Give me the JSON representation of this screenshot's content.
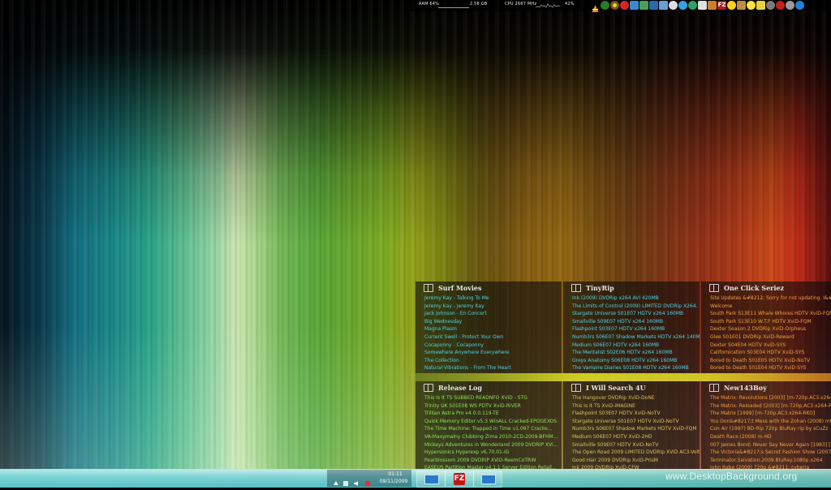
{
  "top_bar": {
    "ram_label": "RAM 64%",
    "ram_value": "2.58 GB",
    "cpu_label": "CPU 2667 MHz",
    "cpu_percent": "42%"
  },
  "feeds": [
    {
      "title": "Surf Movies",
      "color": "cA",
      "items": [
        "Jeremy Kay - Talking To Me",
        "Jeremy Kay - Jeremy Kay",
        "Jack Johnson - En Concert",
        "Big Wednesday",
        "Magna Plasm",
        "Current Swell - Protect Your Own",
        "Cocaponny - Cocaponny",
        "Somewhere Anywhere Everywhere",
        "The Collection",
        "Natural Vibrations - From The Heart"
      ]
    },
    {
      "title": "TinyRip",
      "color": "cA",
      "items": [
        "Ink (2009) DVDRip x264 AVI 420MB",
        "The Limits of Control (2009) LIMITED DVDRip X264...",
        "Stargate Universe S01E07 HDTV x264 160MB",
        "Smallville S09E07 HDTV x264 160MB",
        "Flashpoint S03E07 HDTV x264 160MB",
        "Numb3rs S06E07 Shadow Markets HDTV x264 140MB",
        "Medium S06E07 HDTV x264 160MB",
        "The Mentalist S02E06 HDTV x264 160MB",
        "Greys Anatomy S06E08 HDTV x264 160MB",
        "The Vampire Diaries S01E08 HDTV x264 160MB"
      ]
    },
    {
      "title": "One Click Seriez",
      "color": "cD",
      "items": [
        "Site Updates &#8212; Sorry for not updating. I&#82",
        "Welcome",
        "South Park S13E11 Whale Whores HDTV XviD-FQM",
        "South Park S13E10 W.T.F HDTV XviD-FQM",
        "Dexter Season 2 DVDRip XviD-Orpheus",
        "Glee S01E01 DVDRip XviD-Reward",
        "Dexter S04E04 HDTV XviD-SYS",
        "Californication S03E04 HDTV XviD-SYS",
        "Bored to Death S01E05 HDTV XviD-NoTV",
        "Bored to Death S01E04 HDTV XviD-SYS"
      ]
    },
    {
      "title": "Release Log",
      "color": "cB",
      "items": [
        "This Is It TS SUBBED READNFO XViD - STG",
        "Trinity UK S01E08 WS PDTV XviD-RiVER",
        "Trillian Astra Pro v4.0.0.119-TE",
        "Quick Memory Editor v5.3 WinALL Cracked-EPOGEXOS",
        "The Time Machine: Trapped in Time v1.087 Cracke...",
        "VA-Maxymalny Clubbing Zima 2010-2CD-2009-BFHM...",
        "Mickeys Adventures in Wonderland 2009 DVDRIP XVi...",
        "Hypersonics Hyperexp v6.70.01-iG",
        "Pearblossom 2009 DVDRiP XViD-ReemCoTRiN",
        "EASEUS Partition Master v4.1.1 Server Edition Retail..."
      ]
    },
    {
      "title": "I Will Search 4U",
      "color": "cC",
      "items": [
        "The Hangover DVDRip XviD-DoNE",
        "This Is It TS XviD-iMAGiNE",
        "Flashpoint S03E07 HDTV XviD-NoTV",
        "Stargate Universe S01E07 HDTV XviD-NoTV",
        "Numb3rs S06E07 Shadow Markets HDTV XviD-FQM",
        "Medium S06E07 HDTV XviD-2HD",
        "Smallville S09E07 HDTV XviD-NoTV",
        "The Open Road 2009 LIMITED DVDRip XViD AC3-Volt...",
        "Good Hair 2009 DVDRip XviD-PrisM",
        "Ink 2009 DVDRip XviD-CFW"
      ]
    },
    {
      "title": "New143Boy",
      "color": "cD",
      "items": [
        "The Matrix: Revolutions [2003] [m-720p.AC3.x264-...",
        "The Matrix: Reloaded [2003] [m-720p.AC3.x264-R...",
        "The Matrix [1999] [m-720p.AC3.x264-RKO]",
        "You Don&#8217;t Mess with the Zohan (2008) mkv-...",
        "Con Air (1997) BD-Rip 720p BluRay rip by sCuZz",
        "Death Race (2008) m-HD",
        "007 James Bond: Never Say Never Again [1983] [72...",
        "The Victoria&#8217;s Secret Fashion Show (2007)...",
        "Terminator.Salvation.2009.BluRay.1080p.x264",
        "John Rabe (2009) 720p &#8211; cyberia"
      ]
    }
  ],
  "taskbar": {
    "clock_time": "01:11",
    "clock_date": "09/11/2009",
    "buttons": [
      {
        "icon": "monitor-icon"
      },
      {
        "icon": "filezilla-icon",
        "label": "FZ"
      },
      {
        "icon": "monitor-icon"
      }
    ]
  },
  "watermark": "www.DesktopBackground.org"
}
